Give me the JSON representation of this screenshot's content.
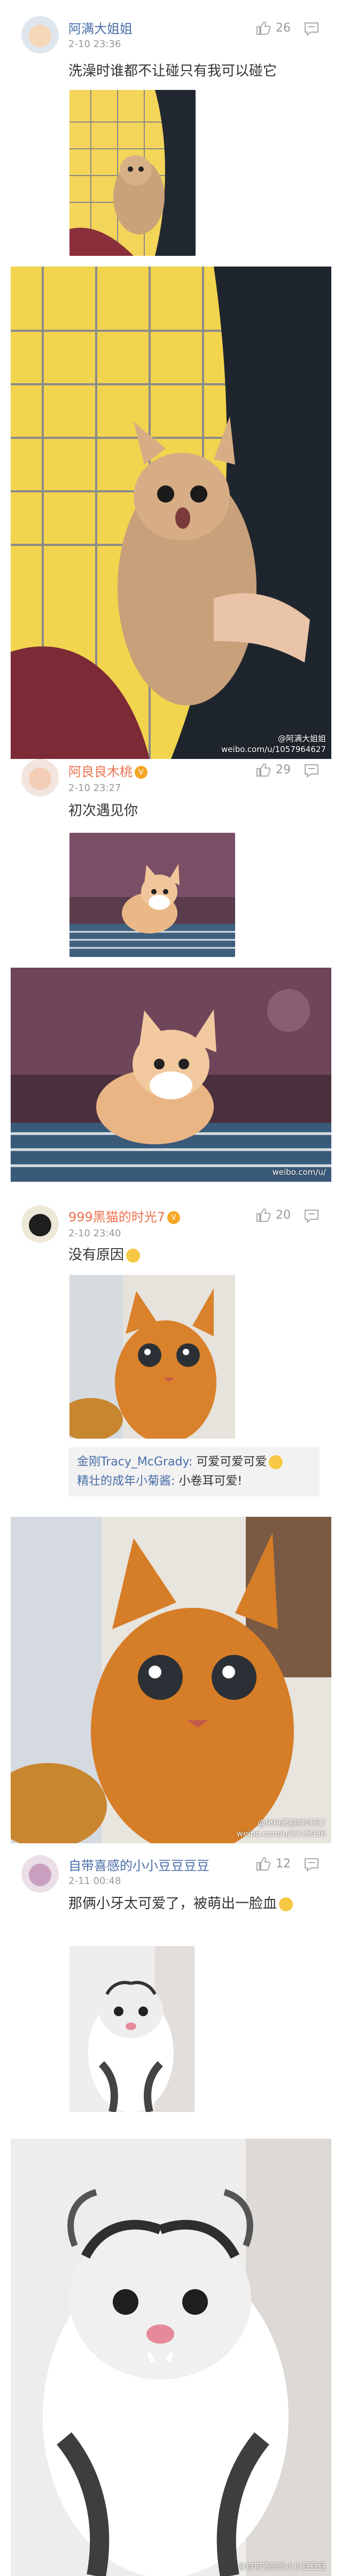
{
  "comments": [
    {
      "username": "阿满大姐姐",
      "time": "2-10 23:36",
      "likes": "26",
      "text": "洗澡时谁都不让碰只有我可以碰它",
      "watermark_line1": "@阿满大姐姐",
      "watermark_line2": "weibo.com/u/1057964627"
    },
    {
      "username": "阿良良木桃",
      "time": "2-10 23:27",
      "likes": "29",
      "text": "初次遇见你",
      "watermark_line1": "weibo.com/u/"
    },
    {
      "username": "999黑猫的时光7",
      "time": "2-10 23:40",
      "likes": "20",
      "text": "没有原因",
      "replies": [
        {
          "name": "金刚Tracy_McGrady:",
          "text": " 可爱可爱可爱"
        },
        {
          "name": "精壮的成年小菊酱:",
          "text": " 小卷耳可爱!"
        }
      ],
      "watermark_line1": "@999黑猫的时光7",
      "watermark_line2": "weibo.com/u/5315936"
    },
    {
      "username": "自带喜感的小小豆豆豆豆",
      "time": "2-11 00:48",
      "likes": "12",
      "text": "那俩小牙太可爱了，被萌出一脸血",
      "watermark_line1": "@自带喜感的小小豆豆豆"
    }
  ],
  "colors": {
    "name_orange": "#eb7350",
    "name_blue": "#4a6ea9",
    "meta_gray": "#999999"
  }
}
